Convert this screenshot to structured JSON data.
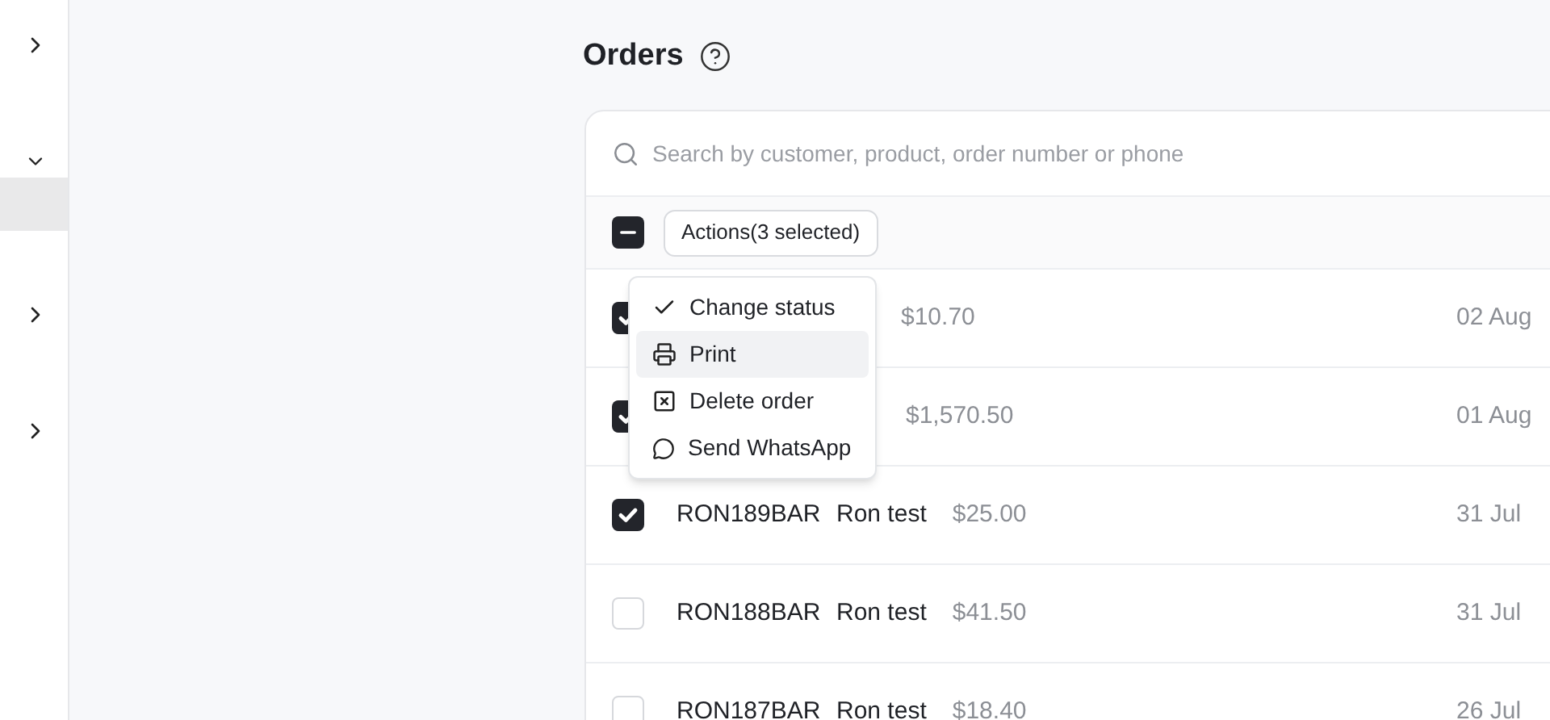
{
  "sidebar": {
    "items": [
      {
        "kind": "group",
        "expanded": false
      },
      {
        "kind": "group",
        "expanded": true
      },
      {
        "kind": "subitem",
        "selected": true
      },
      {
        "kind": "group",
        "expanded": false
      },
      {
        "kind": "group",
        "expanded": false
      }
    ]
  },
  "page": {
    "title": "Orders"
  },
  "search": {
    "placeholder": "Search by customer, product, order number or phone"
  },
  "toolbar": {
    "select_all": {
      "indeterminate": true
    },
    "actions_button": "Actions(3 selected)"
  },
  "actions_menu": [
    {
      "kind": "check",
      "label": "Change status",
      "selected": false
    },
    {
      "kind": "print",
      "label": "Print",
      "selected": true
    },
    {
      "kind": "delete",
      "label": "Delete order",
      "selected": false
    },
    {
      "kind": "whatsapp",
      "label": "Send WhatsApp",
      "selected": false
    }
  ],
  "orders": [
    {
      "checked": true,
      "amount": "$10.70",
      "date": "02 Aug"
    },
    {
      "checked": true,
      "amount": "$1,570.50",
      "date": "01 Aug"
    },
    {
      "checked": true,
      "order": "RON189BAR",
      "customer": "Ron test",
      "amount": "$25.00",
      "date": "31 Jul"
    },
    {
      "checked": false,
      "order": "RON188BAR",
      "customer": "Ron test",
      "amount": "$41.50",
      "date": "31 Jul"
    },
    {
      "checked": false,
      "order": "RON187BAR",
      "customer": "Ron test",
      "amount": "$18.40",
      "date": "26 Jul"
    }
  ]
}
